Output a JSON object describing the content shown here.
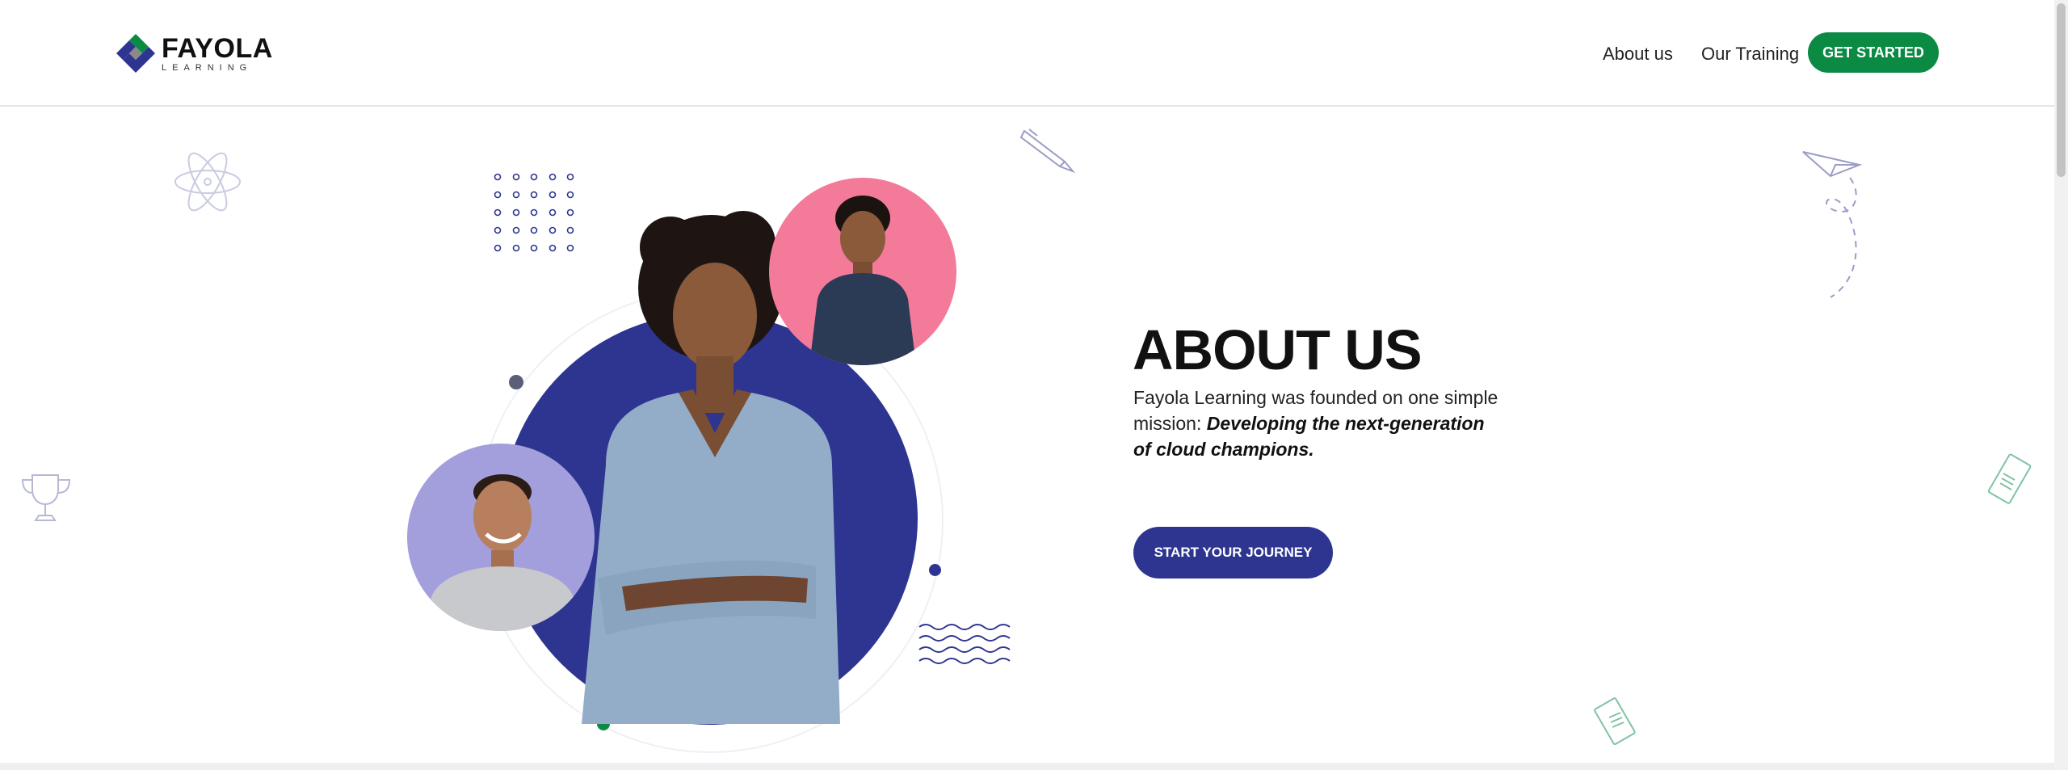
{
  "header": {
    "logo_word": "FAYOLA",
    "logo_sub": "LEARNING",
    "nav": [
      {
        "label": "About us"
      },
      {
        "label": "Our Training"
      }
    ],
    "cta_label": "GET STARTED"
  },
  "hero": {
    "title": "ABOUT US",
    "intro": "Fayola Learning was founded on one simple mission: ",
    "mission": "Developing the next-generation of cloud champions.",
    "button_label": "START YOUR JOURNEY"
  },
  "colors": {
    "brand_green": "#0a8a43",
    "brand_navy": "#2e3590",
    "accent_pink": "#f47a9a",
    "accent_lavender": "#a39fdc"
  },
  "icons": [
    "atom-icon",
    "pen-icon",
    "paper-plane-icon",
    "trophy-icon",
    "notepad-icon",
    "document-icon"
  ]
}
